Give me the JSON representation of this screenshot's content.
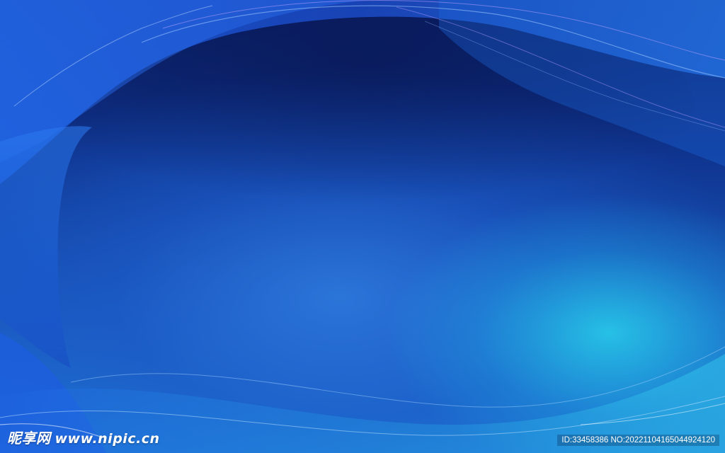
{
  "background": {
    "description_colors": {
      "deep": "#0b1d63",
      "mid": "#1a5ac0",
      "cyan_glow": "#28d2eb"
    }
  },
  "watermark": {
    "logo_cn": "昵享网",
    "logo_url": "www.nipic.cn",
    "id_text": "ID:33458386 NO:20221104165044924120"
  }
}
